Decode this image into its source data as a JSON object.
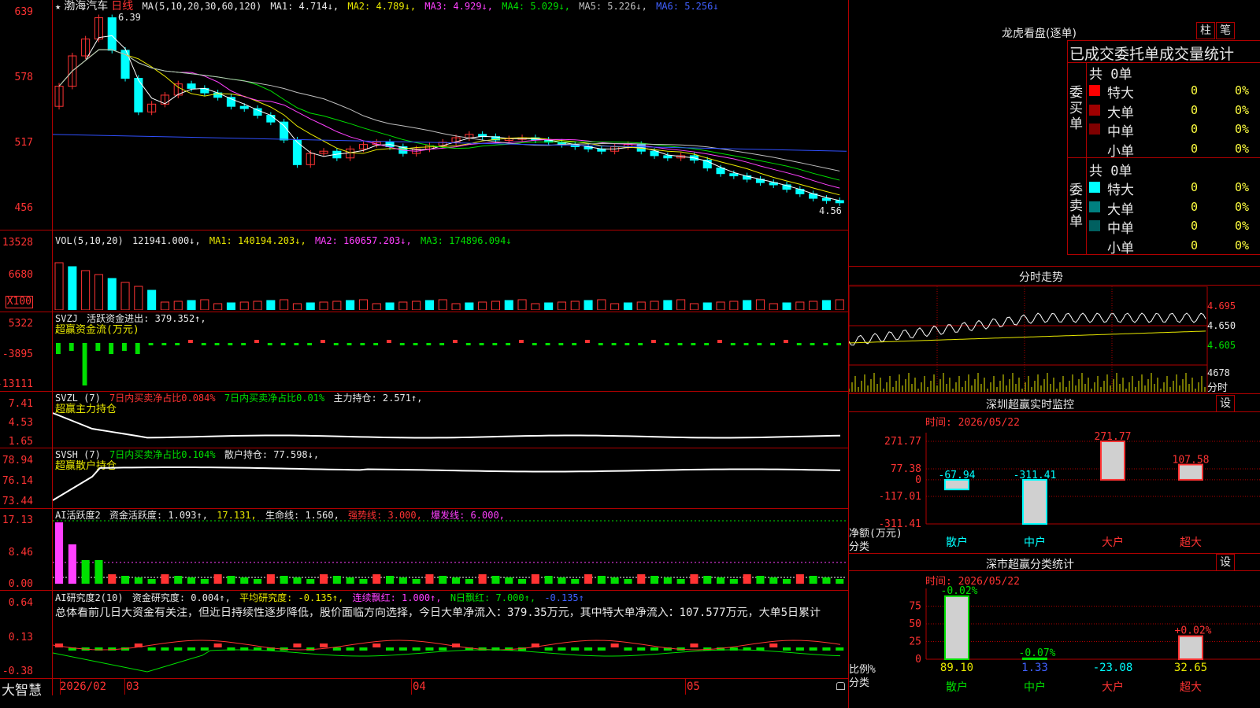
{
  "app_name": "大智慧",
  "candle_header": {
    "star": "★",
    "stock_name": "渤海汽车",
    "period": "日线",
    "ma_def": "MA(5,10,20,30,60,120)",
    "ma1": "MA1: 4.714↓,",
    "ma2": "MA2: 4.789↓,",
    "ma3": "MA3: 4.929↓,",
    "ma4": "MA4: 5.029↓,",
    "ma5": "MA5: 5.226↓,",
    "ma6": "MA6: 5.256↓",
    "high_label": "6.39",
    "low_label": "4.56"
  },
  "candle_axis": [
    "639",
    "578",
    "517",
    "456"
  ],
  "vol_header": {
    "def": "VOL(5,10,20)",
    "vol": "121941.000↓,",
    "ma1": "MA1: 140194.203↓,",
    "ma2": "MA2: 160657.203↓,",
    "ma3": "MA3: 174896.094↓"
  },
  "vol_axis": [
    "13528",
    "6680"
  ],
  "vol_unit": "X100",
  "svzj_header": {
    "def": "SVZJ",
    "text": "活跃资金进出: 379.352↑,",
    "sub": "超赢资金流(万元)"
  },
  "svzj_axis": [
    "5322",
    "-3895",
    "-13111"
  ],
  "svzl_header": {
    "def": "SVZL (7)",
    "t1": "7日内买卖净占比0.084%",
    "t2": "7日内买卖净占比0.01%",
    "t3": "主力持仓: 2.571↑,",
    "sub": "超赢主力持仓"
  },
  "svzl_axis": [
    "7.41",
    "4.53",
    "1.65"
  ],
  "svsh_header": {
    "def": "SVSH (7)",
    "t1": "7日内买卖净占比0.104%",
    "t2": "散户持仓: 77.598↓,",
    "sub": "超赢散户持仓"
  },
  "svsh_axis": [
    "78.94",
    "76.14",
    "73.44"
  ],
  "ai1_header": {
    "def": "AI活跃度2",
    "t1": "资金活跃度: 1.093↑,",
    "t2": "17.131,",
    "t3": "生命线: 1.560,",
    "t4": "强势线: 3.000,",
    "t5": "爆发线: 6.000,"
  },
  "ai1_axis": [
    "17.13",
    "8.46",
    "0.00"
  ],
  "ai2_header": {
    "def": "AI研究度2(10)",
    "t1": "资金研究度: 0.004↑,",
    "t2": "平均研究度: -0.135↑,",
    "t3": "连续飘红: 1.000↑,",
    "t4": "N日飘红: 7.000↑,",
    "t5": "-0.135↑"
  },
  "ai2_summary": "总体看前几日大资金有关注，但近日持续性逐步降低，股价面临方向选择，今日大单净流入：379.35万元，其中特大单净流入：107.577万元，大单5日累计",
  "ai2_axis": [
    "0.64",
    "0.13",
    "-0.38"
  ],
  "date_axis": [
    "2026/02",
    "03",
    "04",
    "05"
  ],
  "right": {
    "dragon_title": "龙虎看盘(逐单)",
    "btn_zhu": "柱",
    "btn_bi": "笔",
    "table_title": "已成交委托单成交量统计",
    "buy_label": [
      "委",
      "买",
      "单"
    ],
    "sell_label": [
      "委",
      "卖",
      "单"
    ],
    "buy_total": "共 0单",
    "sell_total": "共 0单",
    "buy_rows": [
      {
        "name": "特大",
        "count": "0",
        "pct": "0%",
        "color": "#ff0000"
      },
      {
        "name": "大单",
        "count": "0",
        "pct": "0%",
        "color": "#a00000"
      },
      {
        "name": "中单",
        "count": "0",
        "pct": "0%",
        "color": "#800000"
      },
      {
        "name": "小单",
        "count": "0",
        "pct": "0%",
        "color": "#000000"
      }
    ],
    "sell_rows": [
      {
        "name": "特大",
        "count": "0",
        "pct": "0%",
        "color": "#00ffff"
      },
      {
        "name": "大单",
        "count": "0",
        "pct": "0%",
        "color": "#008080"
      },
      {
        "name": "中单",
        "count": "0",
        "pct": "0%",
        "color": "#006060"
      },
      {
        "name": "小单",
        "count": "0",
        "pct": "0%",
        "color": "#000000"
      }
    ],
    "intraday_title": "分时走势",
    "intraday_axis": [
      "4.695",
      "4.650",
      "4.605"
    ],
    "intraday_vol_axis": [
      "4678",
      "分时"
    ],
    "sz_monitor_title": "深圳超赢实时监控",
    "sz_monitor_btn": "设",
    "sz_time": "时间: 2026/05/22",
    "sz_axis": [
      "271.77",
      "77.38",
      "0",
      "-117.01",
      "-311.41"
    ],
    "sz_ylabel": "净额(万元)",
    "sz_xlabel": "分类",
    "sz_categories": [
      "散户",
      "中户",
      "大户",
      "超大"
    ],
    "sz_values": [
      -67.94,
      -311.41,
      271.77,
      107.58
    ],
    "sz_value_labels": [
      "-67.94",
      "-311.41",
      "271.77",
      "107.58"
    ],
    "sc_title": "深市超赢分类统计",
    "sc_btn": "设",
    "sc_time": "时间: 2026/05/22",
    "sc_axis": [
      "75",
      "50",
      "25",
      "0"
    ],
    "sc_ylabel": "比例%",
    "sc_xlabel": "分类",
    "sc_categories": [
      "散户",
      "中户",
      "大户",
      "超大"
    ],
    "sc_bottom_values": [
      "89.10",
      "1.33",
      "-23.08",
      "32.65"
    ],
    "sc_top_labels": [
      "-0.02%",
      "-0.07%",
      "",
      "+0.02%"
    ]
  },
  "chart_data": [
    {
      "type": "bar",
      "title": "深圳超赢实时监控",
      "categories": [
        "散户",
        "中户",
        "大户",
        "超大"
      ],
      "values": [
        -67.94,
        -311.41,
        271.77,
        107.58
      ],
      "ylabel": "净额(万元)",
      "xlabel": "分类",
      "ylim": [
        -311.41,
        271.77
      ]
    },
    {
      "type": "bar",
      "title": "深市超赢分类统计",
      "categories": [
        "散户",
        "中户",
        "大户",
        "超大"
      ],
      "values": [
        89.1,
        1.33,
        -23.08,
        32.65
      ],
      "ylabel": "比例%",
      "xlabel": "分类",
      "ylim": [
        0,
        100
      ]
    }
  ],
  "colors": {
    "up": "#ff3333",
    "down": "#00ffff",
    "grid": "#b00000",
    "ma1": "#ffffff",
    "ma2": "#e8e800",
    "ma3": "#ff40ff",
    "ma4": "#00e000",
    "ma5": "#c0c0c0",
    "ma6": "#3050ff"
  }
}
